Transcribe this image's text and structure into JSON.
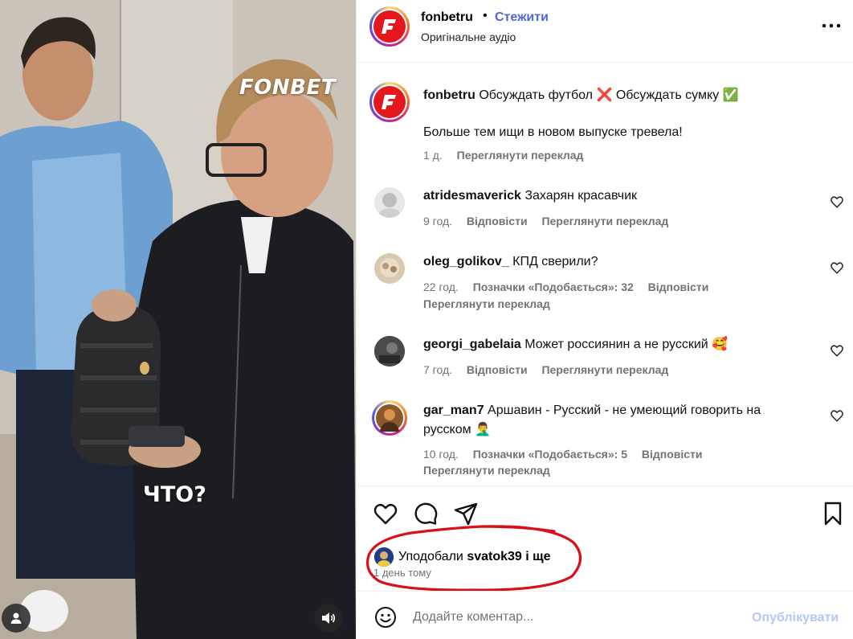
{
  "media": {
    "brand_overlay": "FONBET",
    "caption_overlay": "ЧТО?",
    "tag_icon": "user-tag-icon",
    "sound_icon": "speaker-icon"
  },
  "header": {
    "username": "fonbetru",
    "separator": "•",
    "follow_label": "Стежити",
    "audio_label": "Оригінальне аудіо",
    "more_icon": "more-horizontal-icon"
  },
  "caption": {
    "username": "fonbetru",
    "text_part1": "Обсуждать футбол",
    "emoji1": "❌",
    "text_part2": "Обсуждать сумку",
    "emoji2": "✅",
    "body": "Больше тем ищи в новом выпуске тревела!",
    "time": "1 д.",
    "translate": "Переглянути переклад"
  },
  "comments": [
    {
      "username": "atridesmaverick",
      "text": "Захарян красавчик",
      "time": "9 год.",
      "reply": "Відповісти",
      "translate": "Переглянути переклад"
    },
    {
      "username": "oleg_golikov_",
      "text": "КПД сверили?",
      "time": "22 год.",
      "likes": "Позначки «Подобається»: 32",
      "reply": "Відповісти",
      "translate": "Переглянути переклад"
    },
    {
      "username": "georgi_gabelaia",
      "text": "Может россиянин а не русский",
      "emoji": "🥰",
      "time": "7 год.",
      "reply": "Відповісти",
      "translate": "Переглянути переклад"
    },
    {
      "username": "gar_man7",
      "text": "Аршавин - Русский - не умеющий говорить на русском",
      "emoji": "🤦‍♂️",
      "time": "10 год.",
      "likes": "Позначки «Подобається»: 5",
      "reply": "Відповісти",
      "translate": "Переглянути переклад"
    }
  ],
  "actions": {
    "like_icon": "heart-icon",
    "comment_icon": "comment-icon",
    "share_icon": "share-icon",
    "save_icon": "bookmark-icon",
    "liked_prefix": "Уподобали",
    "liked_user": "svatok39",
    "liked_suffix": "і ще",
    "time_ago": "1 день тому"
  },
  "comment_bar": {
    "emoji_icon": "emoji-icon",
    "placeholder": "Додайте коментар...",
    "publish_label": "Опублікувати"
  },
  "colors": {
    "link_blue": "#4e66d8",
    "publish_disabled": "#b3c8f8",
    "meta_gray": "#737373",
    "highlight_red": "#d8101a",
    "brand_red": "#e4171d"
  }
}
